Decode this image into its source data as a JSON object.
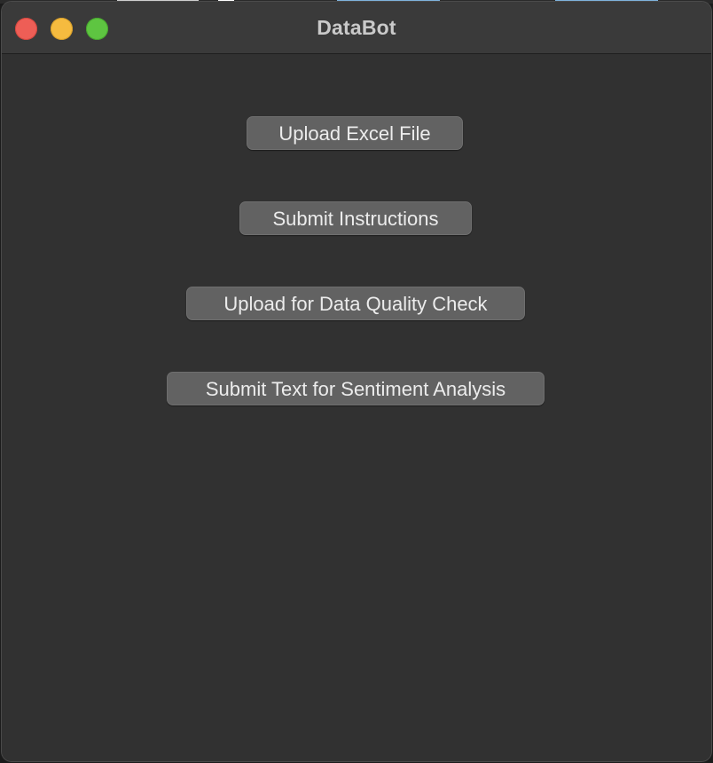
{
  "window": {
    "title": "DataBot"
  },
  "buttons": {
    "upload_excel": "Upload Excel File",
    "submit_instructions": "Submit Instructions",
    "data_quality_check": "Upload for Data Quality Check",
    "sentiment_analysis": "Submit Text for Sentiment Analysis"
  },
  "colors": {
    "window_background": "#313131",
    "titlebar_background": "#3a3a3a",
    "button_background": "#626262",
    "close_button": "#ee5e56",
    "minimize_button": "#f5bb3f",
    "zoom_button": "#5ec541"
  }
}
